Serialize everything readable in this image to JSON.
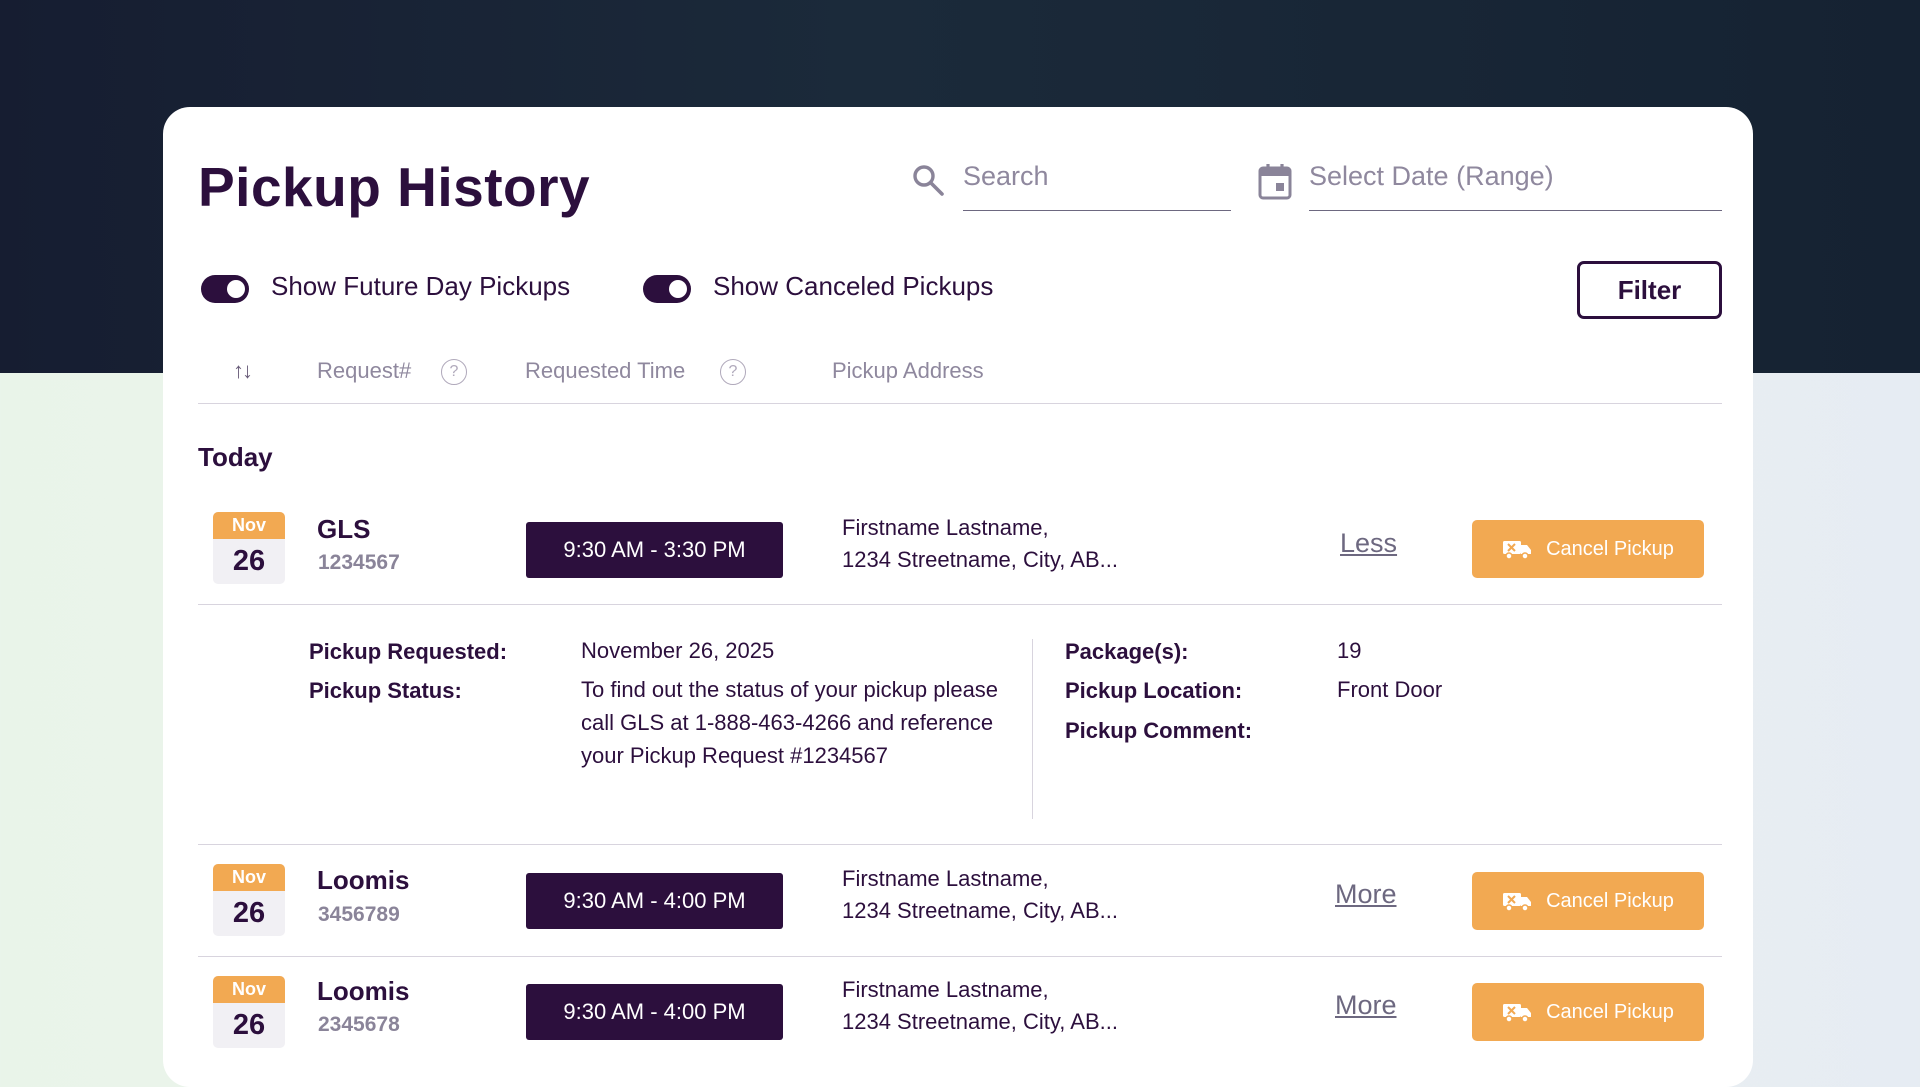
{
  "page": {
    "title": "Pickup History"
  },
  "search": {
    "placeholder": "Search",
    "icon": "search-icon"
  },
  "date_range": {
    "placeholder": "Select Date (Range)",
    "icon": "calendar-icon"
  },
  "toggles": {
    "future": {
      "label": "Show Future Day Pickups",
      "on": true
    },
    "canceled": {
      "label": "Show Canceled Pickups",
      "on": true
    }
  },
  "filter_label": "Filter",
  "columns": {
    "sort_glyph": "↑↓",
    "request": "Request#",
    "requested_time": "Requested Time",
    "pickup_address": "Pickup Address",
    "help_glyph": "?"
  },
  "section": {
    "today": "Today"
  },
  "rows": [
    {
      "month": "Nov",
      "day": "26",
      "carrier": "GLS",
      "request_number": "1234567",
      "time": "9:30 AM - 3:30 PM",
      "address_line1": "Firstname Lastname,",
      "address_line2": "1234 Streetname, City, AB...",
      "toggle_label": "Less",
      "cancel_label": "Cancel Pickup"
    },
    {
      "month": "Nov",
      "day": "26",
      "carrier": "Loomis",
      "request_number": "3456789",
      "time": "9:30 AM - 4:00 PM",
      "address_line1": "Firstname Lastname,",
      "address_line2": "1234 Streetname, City, AB...",
      "toggle_label": "More",
      "cancel_label": "Cancel Pickup"
    },
    {
      "month": "Nov",
      "day": "26",
      "carrier": "Loomis",
      "request_number": "2345678",
      "time": "9:30 AM - 4:00 PM",
      "address_line1": "Firstname Lastname,",
      "address_line2": "1234 Streetname, City, AB...",
      "toggle_label": "More",
      "cancel_label": "Cancel Pickup"
    }
  ],
  "details": {
    "pickup_requested_label": "Pickup Requested:",
    "pickup_requested_value": "November 26, 2025",
    "pickup_status_label": "Pickup Status:",
    "pickup_status_value": "To find out the status of your pickup please call GLS at 1-888-463-4266 and reference your Pickup Request #1234567",
    "packages_label": "Package(s):",
    "packages_value": "19",
    "location_label": "Pickup Location:",
    "location_value": "Front Door",
    "comment_label": "Pickup Comment:"
  },
  "colors": {
    "primary": "#2c0f3d",
    "accent": "#f2a952",
    "muted": "#8f889e",
    "header_band": "#1b2a3a"
  }
}
